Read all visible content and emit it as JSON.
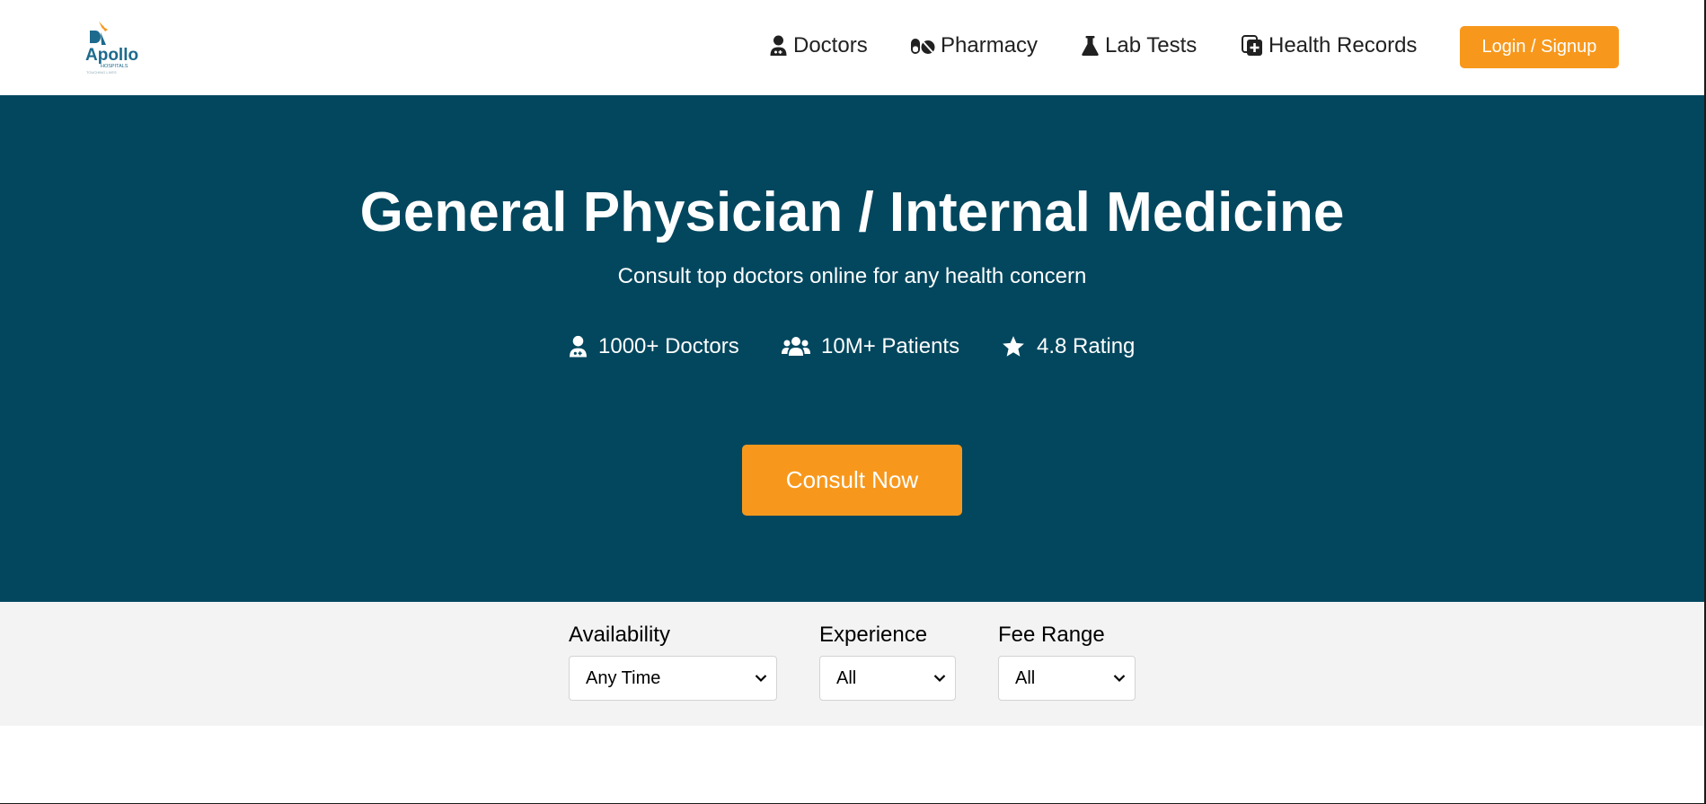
{
  "brand": {
    "logo_text": "Apollo",
    "logo_subtext": "HOSPITALS",
    "logo_tagline": "TOUCHING LIVES",
    "accent_color": "#f7981c",
    "hero_color": "#02475e"
  },
  "nav": {
    "items": [
      {
        "label": "Doctors",
        "icon": "doctor-icon"
      },
      {
        "label": "Pharmacy",
        "icon": "pills-icon"
      },
      {
        "label": "Lab Tests",
        "icon": "flask-icon"
      },
      {
        "label": "Health Records",
        "icon": "records-icon"
      }
    ],
    "login_label": "Login / Signup"
  },
  "hero": {
    "title": "General Physician / Internal Medicine",
    "subtitle": "Consult top doctors online for any health concern",
    "stats": [
      {
        "label": "1000+ Doctors",
        "icon": "doctor-icon"
      },
      {
        "label": "10M+ Patients",
        "icon": "users-icon"
      },
      {
        "label": "4.8 Rating",
        "icon": "star-icon"
      }
    ],
    "cta_label": "Consult Now"
  },
  "filters": {
    "availability": {
      "label": "Availability",
      "value": "Any Time"
    },
    "experience": {
      "label": "Experience",
      "value": "All"
    },
    "fee_range": {
      "label": "Fee Range",
      "value": "All"
    }
  }
}
